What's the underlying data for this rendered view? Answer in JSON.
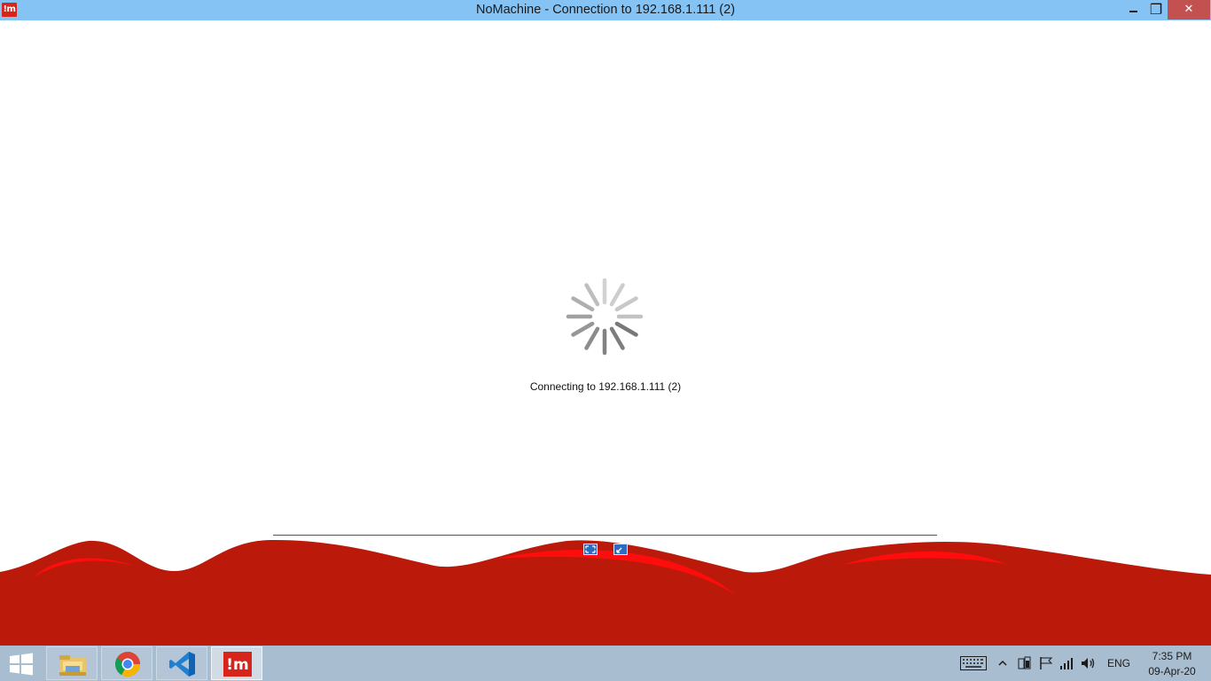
{
  "window": {
    "title": "NoMachine - Connection to 192.168.1.111 (2)",
    "app_icon_text": "!m",
    "minimize_label": "",
    "restore_label": "❐",
    "close_label": "✕"
  },
  "connection": {
    "status": "Connecting to 192.168.1.111 (2)"
  },
  "taskbar": {
    "apps": [
      {
        "icon": "file-explorer-icon",
        "active": false
      },
      {
        "icon": "chrome-icon",
        "active": false
      },
      {
        "icon": "vscode-icon",
        "active": false
      },
      {
        "icon": "nomachine-icon",
        "active": true
      }
    ],
    "nomachine_label": "!m",
    "language": "ENG",
    "time": "7:35 PM",
    "date": "09-Apr-20"
  },
  "colors": {
    "titlebar": "#85c3f4",
    "brand_red": "#bb1a0a",
    "highlight_red": "#ff0d0d",
    "taskbar": "#a9bdd1",
    "close_button": "#c2514f"
  }
}
